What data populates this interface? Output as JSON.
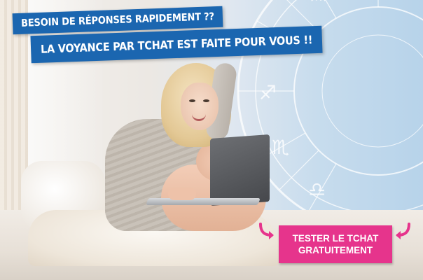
{
  "banner": {
    "line1": "BESOIN DE RÉPONSES RAPIDEMENT ??",
    "line2": "LA VOYANCE PAR TCHAT EST FAITE POUR VOUS !!"
  },
  "cta": {
    "line1": "TESTER LE TCHAT",
    "line2": "GRATUITEMENT"
  },
  "icons": {
    "left_arrow": "curved-arrow-icon",
    "right_arrow": "curved-arrow-icon",
    "zodiac": "zodiac-wheel-icon"
  },
  "colors": {
    "banner_blue": "#1b66b0",
    "cta_pink": "#e6348c",
    "text_white": "#ffffff"
  }
}
